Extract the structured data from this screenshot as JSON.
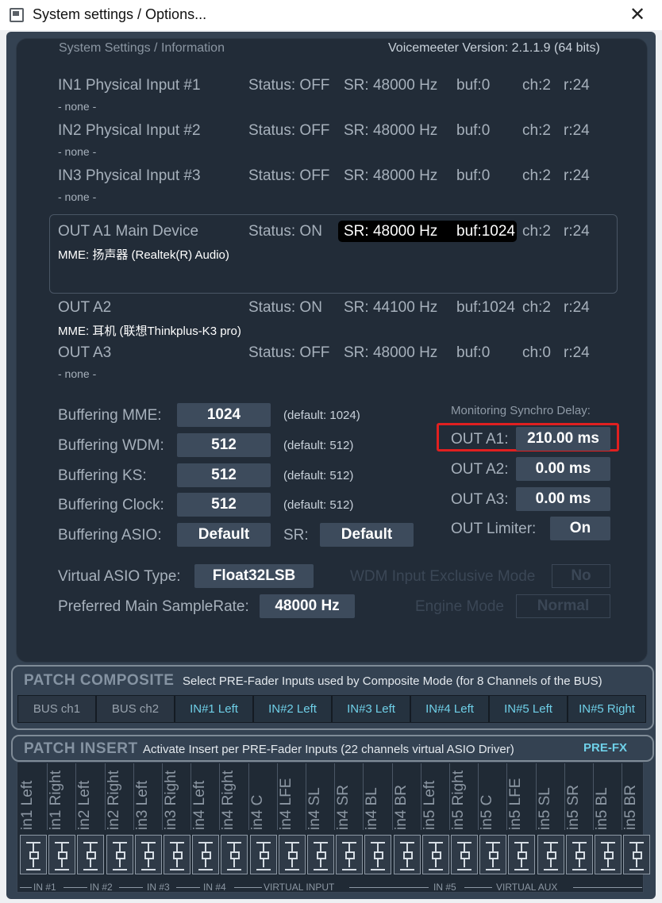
{
  "window": {
    "title": "System settings / Options..."
  },
  "header": {
    "section": "System Settings / Information",
    "version": "Voicemeeter Version: 2.1.1.9 (64 bits)"
  },
  "devices": [
    {
      "name": "IN1 Physical Input #1",
      "status": "Status: OFF",
      "sr": "SR: 48000 Hz",
      "buf": "buf:0",
      "ch": "ch:2",
      "r": "r:24",
      "driver": "- none -"
    },
    {
      "name": "IN2 Physical Input #2",
      "status": "Status: OFF",
      "sr": "SR: 48000 Hz",
      "buf": "buf:0",
      "ch": "ch:2",
      "r": "r:24",
      "driver": "- none -"
    },
    {
      "name": "IN3 Physical Input #3",
      "status": "Status: OFF",
      "sr": "SR: 48000 Hz",
      "buf": "buf:0",
      "ch": "ch:2",
      "r": "r:24",
      "driver": "- none -"
    },
    {
      "name": "OUT A1 Main Device",
      "status": "Status: ON",
      "sr": "SR: 48000 Hz",
      "buf": "buf:1024",
      "ch": "ch:2",
      "r": "r:24",
      "driver": "MME: 扬声器 (Realtek(R) Audio)"
    },
    {
      "name": "OUT A2",
      "status": "Status: ON",
      "sr": "SR: 44100 Hz",
      "buf": "buf:1024",
      "ch": "ch:2",
      "r": "r:24",
      "driver": "MME: 耳机 (联想Thinkplus-K3 pro)"
    },
    {
      "name": "OUT A3",
      "status": "Status: OFF",
      "sr": "SR: 48000 Hz",
      "buf": "buf:0",
      "ch": "ch:0",
      "r": "r:24",
      "driver": "- none -"
    }
  ],
  "buffering": {
    "mme": {
      "label": "Buffering MME:",
      "value": "1024",
      "default": "(default: 1024)"
    },
    "wdm": {
      "label": "Buffering WDM:",
      "value": "512",
      "default": "(default: 512)"
    },
    "ks": {
      "label": "Buffering KS:",
      "value": "512",
      "default": "(default: 512)"
    },
    "clock": {
      "label": "Buffering Clock:",
      "value": "512",
      "default": "(default: 512)"
    },
    "asio": {
      "label": "Buffering ASIO:",
      "value": "Default",
      "sr_label": "SR:",
      "sr_value": "Default"
    }
  },
  "monitoring": {
    "title": "Monitoring Synchro Delay:",
    "a1": {
      "label": "OUT A1:",
      "value": "210.00 ms"
    },
    "a2": {
      "label": "OUT A2:",
      "value": "0.00 ms"
    },
    "a3": {
      "label": "OUT A3:",
      "value": "0.00 ms"
    },
    "limiter": {
      "label": "OUT Limiter:",
      "value": "On"
    }
  },
  "asio_type": {
    "label": "Virtual ASIO Type:",
    "value": "Float32LSB"
  },
  "samplerate": {
    "label": "Preferred Main SampleRate:",
    "value": "48000 Hz"
  },
  "wdm_exclusive": {
    "label": "WDM Input Exclusive Mode",
    "value": "No"
  },
  "engine": {
    "label": "Engine Mode",
    "value": "Normal"
  },
  "patch_composite": {
    "title": "PATCH COMPOSITE",
    "desc": "Select PRE-Fader Inputs used by Composite Mode (for 8 Channels of the BUS)",
    "buttons": [
      "BUS ch1",
      "BUS ch2",
      "IN#1 Left",
      "IN#2 Left",
      "IN#3 Left",
      "IN#4 Left",
      "IN#5 Left",
      "IN#5 Right"
    ]
  },
  "patch_insert": {
    "title": "PATCH INSERT",
    "desc": "Activate Insert per PRE-Fader Inputs (22 channels virtual ASIO Driver)",
    "mode": "PRE-FX",
    "channels": [
      "in1 Left",
      "in1 Right",
      "in2 Left",
      "in2 Right",
      "in3 Left",
      "in3 Right",
      "in4 Left",
      "in4 Right",
      "in4 C",
      "in4 LFE",
      "in4 SL",
      "in4 SR",
      "in4 BL",
      "in4 BR",
      "in5 Left",
      "in5 Right",
      "in5 C",
      "in5 LFE",
      "in5 SL",
      "in5 SR",
      "in5 BL",
      "in5 BR"
    ],
    "groups": [
      "IN #1",
      "IN #2",
      "IN #3",
      "IN #4",
      "VIRTUAL INPUT",
      "IN #5",
      "VIRTUAL AUX"
    ]
  },
  "colors": {
    "panel": "#344252",
    "inner": "#222c38",
    "highlight_red": "#e02020",
    "accent_cyan": "#6fd0e8"
  }
}
